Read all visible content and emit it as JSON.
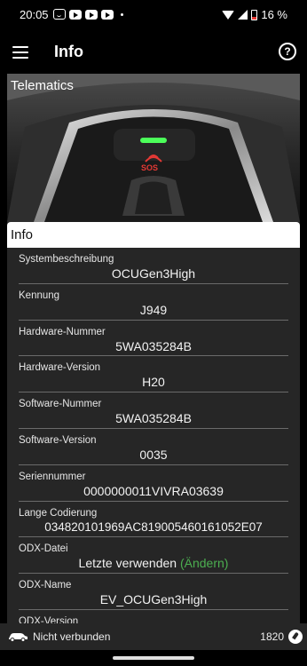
{
  "status_bar": {
    "time": "20:05",
    "battery": "16 %"
  },
  "app_bar": {
    "title": "Info",
    "help": "?"
  },
  "hero": {
    "title": "Telematics",
    "sos_label": "SOS"
  },
  "info_card": {
    "header": "Info",
    "rows": [
      {
        "label": "Systembeschreibung",
        "value": "OCUGen3High"
      },
      {
        "label": "Kennung",
        "value": "J949"
      },
      {
        "label": "Hardware-Nummer",
        "value": "5WA035284B"
      },
      {
        "label": "Hardware-Version",
        "value": "H20"
      },
      {
        "label": "Software-Nummer",
        "value": "5WA035284B"
      },
      {
        "label": "Software-Version",
        "value": "0035"
      },
      {
        "label": "Seriennummer",
        "value": "0000000011VIVRA03639"
      },
      {
        "label": "Lange Codierung",
        "value": "034820101969AC819005460161052E07"
      },
      {
        "label": "ODX-Datei",
        "value": "Letzte verwenden",
        "action": "(Ändern)"
      },
      {
        "label": "ODX-Name",
        "value": "EV_OCUGen3High"
      },
      {
        "label": "ODX-Version",
        "value": ""
      }
    ]
  },
  "footer": {
    "connection_status": "Nicht verbunden",
    "count": "1820"
  },
  "colors": {
    "accent_green": "#4caf50",
    "battery_red": "#e53935",
    "card_bg": "#262626"
  }
}
